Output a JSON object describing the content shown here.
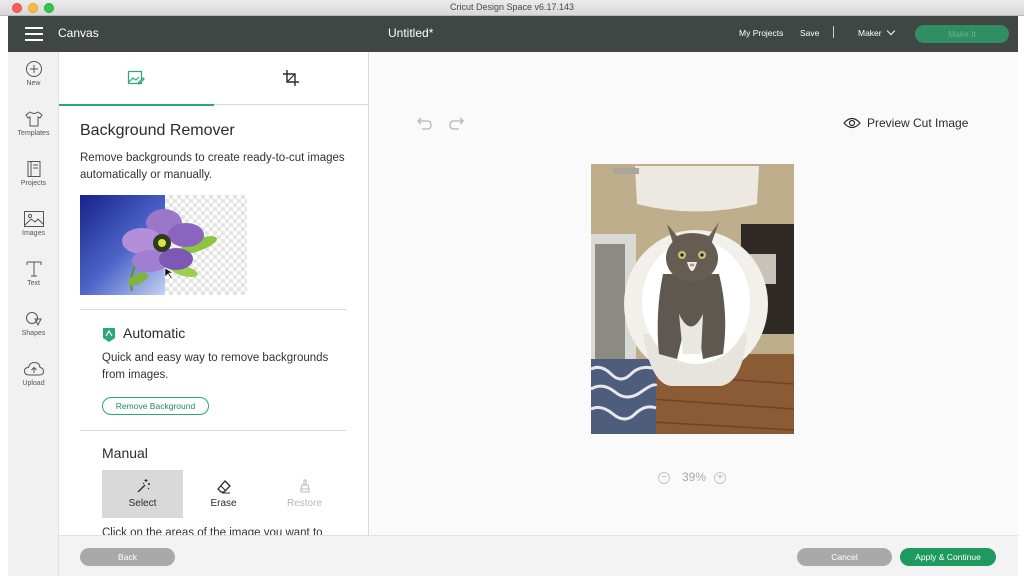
{
  "window": {
    "title": "Cricut Design Space  v6.17.143"
  },
  "header": {
    "section": "Canvas",
    "document_title": "Untitled*",
    "my_projects": "My Projects",
    "save": "Save",
    "separator": "|",
    "machine": "Maker",
    "make_it": "Make It"
  },
  "rail": {
    "items": [
      {
        "label": "New",
        "icon": "plus-circle-icon"
      },
      {
        "label": "Templates",
        "icon": "tshirt-icon"
      },
      {
        "label": "Projects",
        "icon": "book-icon"
      },
      {
        "label": "Images",
        "icon": "image-icon"
      },
      {
        "label": "Text",
        "icon": "text-icon"
      },
      {
        "label": "Shapes",
        "icon": "shapes-icon"
      },
      {
        "label": "Upload",
        "icon": "cloud-upload-icon"
      }
    ]
  },
  "panel": {
    "tabs": [
      {
        "icon": "image-edit-icon",
        "active": true
      },
      {
        "icon": "crop-icon",
        "active": false
      }
    ],
    "title": "Background Remover",
    "description": "Remove backgrounds to create ready-to-cut images automatically or manually.",
    "automatic": {
      "title": "Automatic",
      "description": "Quick and easy way to remove backgrounds from images.",
      "button": "Remove Background"
    },
    "manual": {
      "title": "Manual",
      "tools": [
        {
          "label": "Select",
          "icon": "magic-wand-icon",
          "state": "active"
        },
        {
          "label": "Erase",
          "icon": "eraser-icon",
          "state": "enabled"
        },
        {
          "label": "Restore",
          "icon": "restore-brush-icon",
          "state": "disabled"
        }
      ],
      "instructions": "Click on the areas of the image you want to"
    }
  },
  "canvas": {
    "preview_cut": "Preview Cut Image",
    "zoom": {
      "value": "39%",
      "minus": "−",
      "plus": "+"
    }
  },
  "footer": {
    "back": "Back",
    "cancel": "Cancel",
    "apply": "Apply & Continue"
  },
  "colors": {
    "header_bg": "#404644",
    "accent_green": "#2aa876",
    "apply_green": "#1f9a5f"
  }
}
